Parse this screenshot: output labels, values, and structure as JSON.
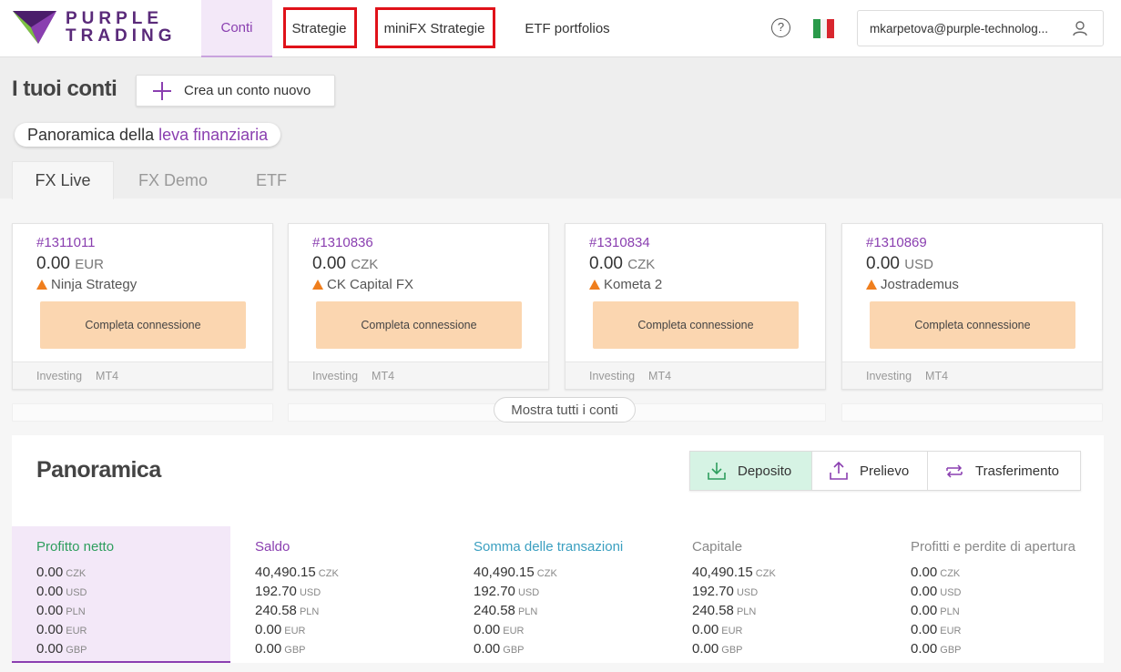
{
  "brand": {
    "line1": "PURPLE",
    "line2": "TRADING"
  },
  "nav": {
    "conti": "Conti",
    "strategie": "Strategie",
    "minifx": "miniFX Strategie",
    "etf": "ETF portfolios"
  },
  "header": {
    "help_symbol": "?",
    "language": "Italiano",
    "user_email": "mkarpetova@purple-technolog..."
  },
  "page": {
    "title": "I tuoi conti",
    "new_account": "Crea un conto nuovo",
    "leva_prefix": "Panoramica della ",
    "leva_link": "leva finanziaria"
  },
  "tabs": [
    "FX Live",
    "FX Demo",
    "ETF"
  ],
  "cards": [
    {
      "id": "#1311011",
      "amount": "0.00",
      "currency": "EUR",
      "name": "Ninja Strategy",
      "button": "Completa connessione",
      "type": "Investing",
      "platform": "MT4"
    },
    {
      "id": "#1310836",
      "amount": "0.00",
      "currency": "CZK",
      "name": "CK Capital FX",
      "button": "Completa connessione",
      "type": "Investing",
      "platform": "MT4"
    },
    {
      "id": "#1310834",
      "amount": "0.00",
      "currency": "CZK",
      "name": "Kometa 2",
      "button": "Completa connessione",
      "type": "Investing",
      "platform": "MT4"
    },
    {
      "id": "#1310869",
      "amount": "0.00",
      "currency": "USD",
      "name": "Jostrademus",
      "button": "Completa connessione",
      "type": "Investing",
      "platform": "MT4"
    }
  ],
  "show_all": "Mostra tutti i conti",
  "overview": {
    "title": "Panoramica",
    "actions": {
      "deposit": "Deposito",
      "withdraw": "Prelievo",
      "transfer": "Trasferimento"
    },
    "stats": [
      {
        "title": "Profitto netto",
        "color": "#2e9e5e",
        "rows": [
          [
            "0.00",
            "CZK"
          ],
          [
            "0.00",
            "USD"
          ],
          [
            "0.00",
            "PLN"
          ],
          [
            "0.00",
            "EUR"
          ],
          [
            "0.00",
            "GBP"
          ]
        ]
      },
      {
        "title": "Saldo",
        "color": "#8a3fb0",
        "rows": [
          [
            "40,490.15",
            "CZK"
          ],
          [
            "192.70",
            "USD"
          ],
          [
            "240.58",
            "PLN"
          ],
          [
            "0.00",
            "EUR"
          ],
          [
            "0.00",
            "GBP"
          ]
        ]
      },
      {
        "title": "Somma delle transazioni",
        "color": "#3a9fc0",
        "rows": [
          [
            "40,490.15",
            "CZK"
          ],
          [
            "192.70",
            "USD"
          ],
          [
            "240.58",
            "PLN"
          ],
          [
            "0.00",
            "EUR"
          ],
          [
            "0.00",
            "GBP"
          ]
        ]
      },
      {
        "title": "Capitale",
        "color": "#888888",
        "rows": [
          [
            "40,490.15",
            "CZK"
          ],
          [
            "192.70",
            "USD"
          ],
          [
            "240.58",
            "PLN"
          ],
          [
            "0.00",
            "EUR"
          ],
          [
            "0.00",
            "GBP"
          ]
        ]
      },
      {
        "title": "Profitti e perdite di apertura",
        "color": "#888888",
        "rows": [
          [
            "0.00",
            "CZK"
          ],
          [
            "0.00",
            "USD"
          ],
          [
            "0.00",
            "PLN"
          ],
          [
            "0.00",
            "EUR"
          ],
          [
            "0.00",
            "GBP"
          ]
        ]
      }
    ]
  },
  "colors": {
    "accent": "#8a3fb0",
    "highlight_box": "#e0121a",
    "connect_button": "#fbd6b0",
    "deposit_bg": "#d6f3e4"
  }
}
